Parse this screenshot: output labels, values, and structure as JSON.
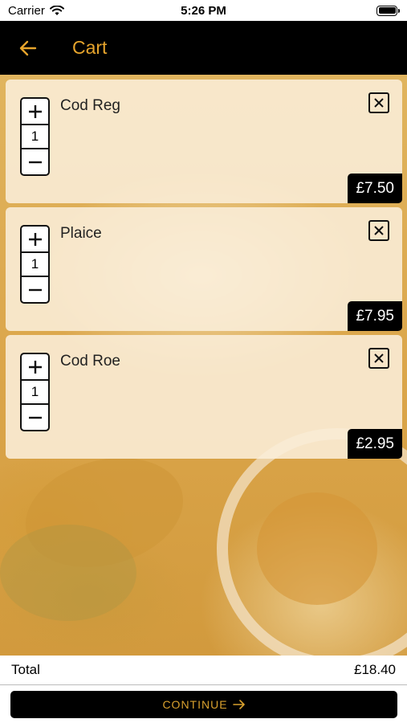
{
  "status_bar": {
    "carrier": "Carrier",
    "time": "5:26 PM"
  },
  "header": {
    "title": "Cart",
    "back_icon": "arrow-left-icon"
  },
  "cart": {
    "items": [
      {
        "name": "Cod Reg",
        "quantity": "1",
        "price": "£7.50"
      },
      {
        "name": "Plaice",
        "quantity": "1",
        "price": "£7.95"
      },
      {
        "name": "Cod Roe",
        "quantity": "1",
        "price": "£2.95"
      }
    ]
  },
  "footer": {
    "total_label": "Total",
    "total_value": "£18.40",
    "continue_label": "CONTINUE"
  },
  "colors": {
    "accent": "#e6a42c",
    "nav_bg": "#000000",
    "card_bg": "#faeeda"
  }
}
